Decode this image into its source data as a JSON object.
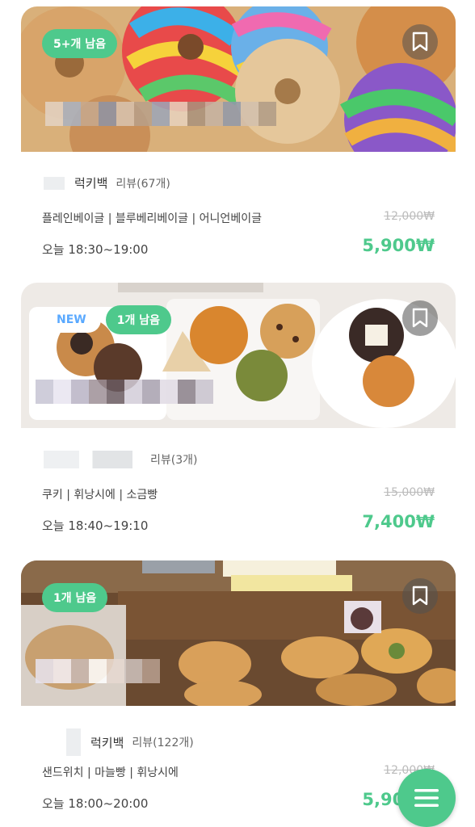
{
  "listings": [
    {
      "badge": "5+개 남음",
      "new_label": "",
      "brand": "럭키백",
      "reviews": "리뷰(67개)",
      "menu": "플레인베이글 | 블루베리베이글 | 어니언베이글",
      "original_price": "12,000₩",
      "time": "오늘 18:30~19:00",
      "price": "5,900₩"
    },
    {
      "badge": "1개 남음",
      "new_label": "NEW",
      "brand": "",
      "reviews": "리뷰(3개)",
      "menu": "쿠키 | 휘낭시에 | 소금빵",
      "original_price": "15,000₩",
      "time": "오늘 18:40~19:10",
      "price": "7,400₩"
    },
    {
      "badge": "1개 남음",
      "new_label": "",
      "brand": "럭키백",
      "reviews": "리뷰(122개)",
      "menu": "샌드위치 | 마늘빵 | 휘낭시에",
      "original_price": "12,000₩",
      "time": "오늘 18:00~20:00",
      "price": "5,900₩"
    }
  ],
  "icons": {
    "bookmark": "bookmark-icon",
    "menu": "hamburger-menu-icon"
  },
  "colors": {
    "accent": "#4ec98c",
    "new_badge_text": "#5aa9ff",
    "strike_price": "#bbbbbb"
  }
}
